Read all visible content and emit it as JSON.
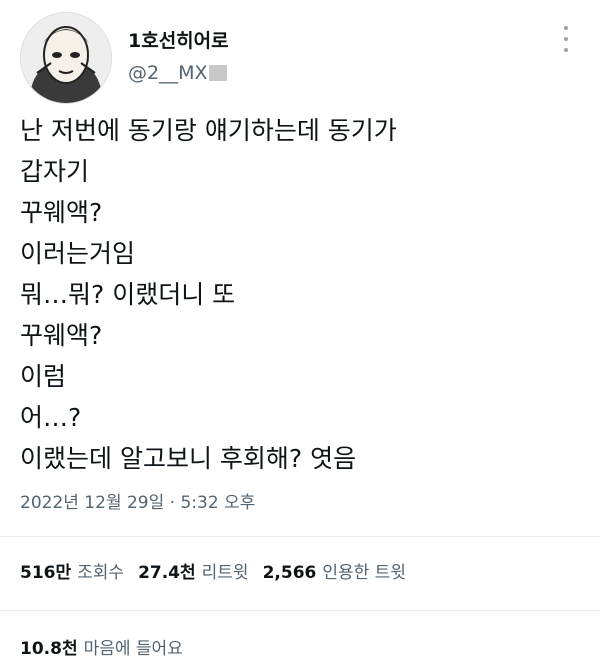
{
  "author": {
    "display_name": "1호선히어로",
    "handle": "@2__MX",
    "avatar_icon": "anime-character-avatar"
  },
  "menu_icon": "more-vertical-icon",
  "tweet": {
    "lines": [
      "난 저번에 동기랑 얘기하는데 동기가",
      "갑자기",
      "꾸웨액?",
      "이러는거임",
      "뭐…뭐? 이랬더니 또",
      "꾸웨액?",
      "이럼",
      "어…?",
      "이랬는데 알고보니 후회해? 엿음"
    ]
  },
  "timestamp": "2022년 12월 29일 · 5:32 오후",
  "stats": {
    "views_count": "516만",
    "views_label": "조회수",
    "retweets_count": "27.4천",
    "retweets_label": "리트윗",
    "quotes_count": "2,566",
    "quotes_label": "인용한 트윗"
  },
  "likes": {
    "count": "10.8천",
    "label": "마음에 들어요"
  },
  "colors": {
    "text": "#0f1419",
    "muted": "#536471",
    "divider": "#e6ecf0"
  }
}
